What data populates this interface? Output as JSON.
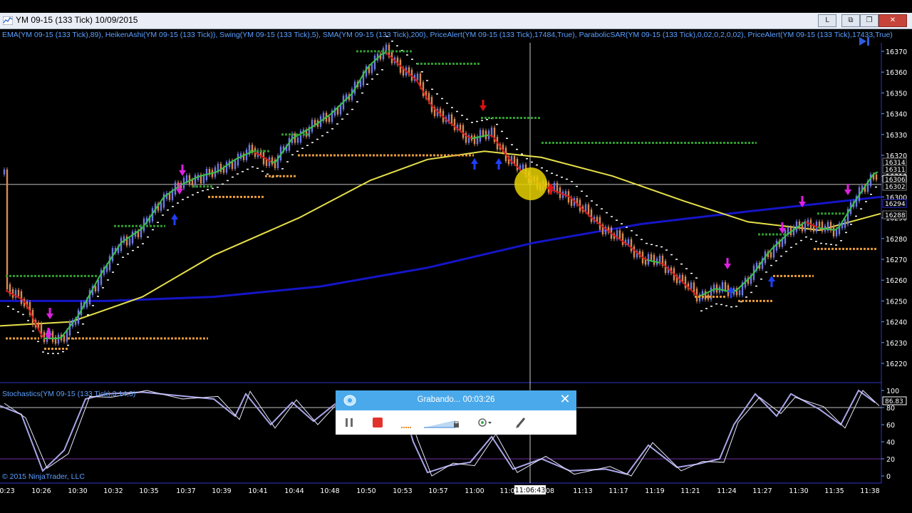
{
  "window": {
    "title": "YM 09-15 (133 Tick)  10/09/2015",
    "buttons": [
      "L",
      "⧉",
      "❐",
      "✕"
    ]
  },
  "indicators_text": "EMA(YM 09-15 (133 Tick),89), HeikenAshi(YM 09-15 (133 Tick)), Swing(YM 09-15 (133 Tick),5), SMA(YM 09-15 (133 Tick),200), PriceAlert(YM 09-15 (133 Tick),17484,True), ParabolicSAR(YM 09-15 (133 Tick),0,02,0,2,0,02), PriceAlert(YM 09-15 (133 Tick),17433,True)",
  "price_axis": {
    "ticks": [
      "16370",
      "16360",
      "16350",
      "16340",
      "16330",
      "16320",
      "16310",
      "16300",
      "16290",
      "16280",
      "16270",
      "16260",
      "16250",
      "16240",
      "16230",
      "16220"
    ],
    "boxes": [
      "16314",
      "16311",
      "16306",
      "16302",
      "16294",
      "16288"
    ],
    "colors": {
      "16314": "#7a7a7a",
      "16311": "#7a7a7a",
      "16306": "#ffffff",
      "16302": "#7a7a7a",
      "16294": "#2d2dd9",
      "16288": "#7a7a7a"
    }
  },
  "crosshair": {
    "price": "16306"
  },
  "stochastics": {
    "label": "Stochastics(YM 09-15 (133 Tick),3,14,3)",
    "ticks": [
      "100",
      "80",
      "60",
      "40",
      "20",
      "0"
    ],
    "current": "86.83"
  },
  "time_axis": {
    "labels": [
      "0:23",
      "10:26",
      "10:30",
      "10:32",
      "10:35",
      "10:37",
      "10:39",
      "10:41",
      "10:44",
      "10:48",
      "10:50",
      "10:53",
      "10:57",
      "11:00",
      "11:0",
      "08",
      "11:13",
      "11:17",
      "11:19",
      "11:21",
      "11:24",
      "11:27",
      "11:30",
      "11:35",
      "11:38"
    ],
    "crosshair_time": "11:06:43"
  },
  "copyright": "© 2015 NinjaTrader, LLC",
  "recorder": {
    "status": "Grabando...   00:03:26",
    "close": "✕"
  },
  "colors": {
    "background": "#000000",
    "ema": "#1515c8",
    "sma": "#e6e04a",
    "heiken_up": "#6d7be0",
    "heiken_down": "#d98a53",
    "trend_up": "#38c24a",
    "trend_down": "#d21a1a",
    "swing_high": "#2f9b2f",
    "swing_low": "#e89a3a",
    "stoch_k": "#a9a6e8",
    "stoch_d": "#e8e8ff",
    "highlight": "#e8d200"
  }
}
